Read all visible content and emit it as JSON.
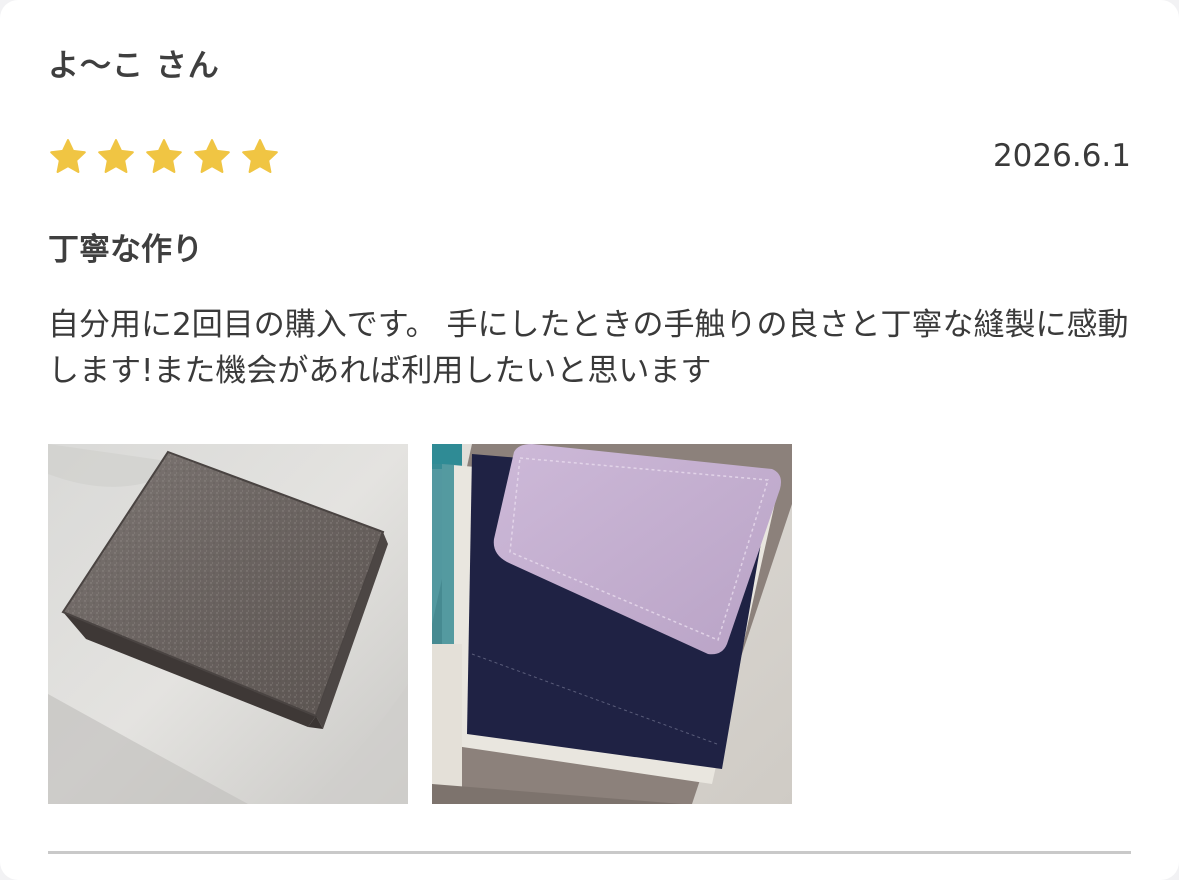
{
  "review": {
    "reviewer_name": "よ〜こ さん",
    "rating": 5,
    "rating_max": 5,
    "star_color": "#f0c543",
    "date": "2026.6.1",
    "title": "丁寧な作り",
    "body": "自分用に2回目の購入です。 手にしたときの手触りの良さと丁寧な縫製に感動します!また機会があれば利用したいと思います"
  },
  "photos": [
    {
      "name": "wallet-closed-photo"
    },
    {
      "name": "wallet-open-photo"
    }
  ]
}
